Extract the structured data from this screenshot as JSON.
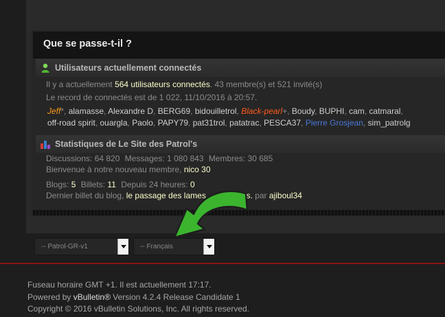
{
  "wgo": {
    "title": "Que se passe-t-il ?",
    "online": {
      "title": "Utilisateurs actuellement connectés",
      "line1_prefix": "Il y a actuellement",
      "line1_count": "564 utilisateurs connectés",
      "line1_suffix": ". 43 membre(s) et 521 invité(s)",
      "record": "Le record de connectés est de 1 022, 11/10/2016 à 20:57.",
      "users_row1": [
        {
          "name": "Jeff",
          "style": "jeff",
          "sep": "*, "
        },
        {
          "name": "alamasse",
          "style": "normal",
          "sep": ", "
        },
        {
          "name": "Alexandre D",
          "style": "normal",
          "sep": ", "
        },
        {
          "name": "BERG69",
          "style": "normal",
          "sep": ", "
        },
        {
          "name": "bidouilletrol",
          "style": "normal",
          "sep": ", "
        },
        {
          "name": "Black-pearl",
          "style": "blackpearl",
          "sep": "+, "
        },
        {
          "name": "Boudy",
          "style": "normal",
          "sep": ", "
        },
        {
          "name": "BUPHI",
          "style": "normal",
          "sep": ", "
        },
        {
          "name": "cam",
          "style": "normal",
          "sep": ", "
        },
        {
          "name": "catmaral",
          "style": "normal",
          "sep": ","
        }
      ],
      "users_row2": [
        {
          "name": "off-road spirit",
          "style": "normal",
          "sep": ", "
        },
        {
          "name": "ouargla",
          "style": "normal",
          "sep": ", "
        },
        {
          "name": "Paolo",
          "style": "normal",
          "sep": ", "
        },
        {
          "name": "PAPY79",
          "style": "normal",
          "sep": ", "
        },
        {
          "name": "pat31trol",
          "style": "normal",
          "sep": ", "
        },
        {
          "name": "patatrac",
          "style": "normal",
          "sep": ", "
        },
        {
          "name": "PESCA37",
          "style": "normal",
          "sep": ", "
        },
        {
          "name": "Pierre Grosjean",
          "style": "pierre",
          "sep": ", "
        },
        {
          "name": "sim_patrolg",
          "style": "normal",
          "sep": ""
        }
      ]
    },
    "stats": {
      "title": "Statistiques de Le Site des Patrol's",
      "discussions_label": "Discussions:",
      "discussions": "64 820",
      "messages_label": "Messages:",
      "messages": "1 080 843",
      "members_label": "Membres:",
      "members": "30 685",
      "welcome_prefix": "Bienvenue à notre nouveau membre,",
      "newest_member": "nico 30",
      "blogs_label": "Blogs:",
      "blogs": "5",
      "entries_label": "Billets:",
      "entries": "11",
      "last24_label": "Depuis 24 heures:",
      "last24": "0",
      "lastblog_prefix": "Dernier billet du blog,",
      "lastblog_title": "le passage des lames ... les ponts.",
      "lastblog_by": "par",
      "lastblog_author": "ajiboul34"
    }
  },
  "selects": {
    "style_value": "-- Patrol-GR-v1",
    "language_value": "-- Français"
  },
  "footer": {
    "timezone": "Fuseau horaire GMT +1. Il est actuellement 17:17.",
    "powered_prefix": "Powered by",
    "powered_brand": "vBulletin®",
    "powered_suffix": "Version 4.2.4 Release Candidate 1",
    "copyright": "Copyright © 2016 vBulletin Solutions, Inc. All rights reserved."
  },
  "colors": {
    "arrow": "#3bb52e",
    "red_rule": "#8a1414",
    "highlight": "#ffffcc",
    "jeff": "#ff9a1a",
    "blackpearl": "#ff5a1a",
    "pierre": "#4a78d8"
  }
}
